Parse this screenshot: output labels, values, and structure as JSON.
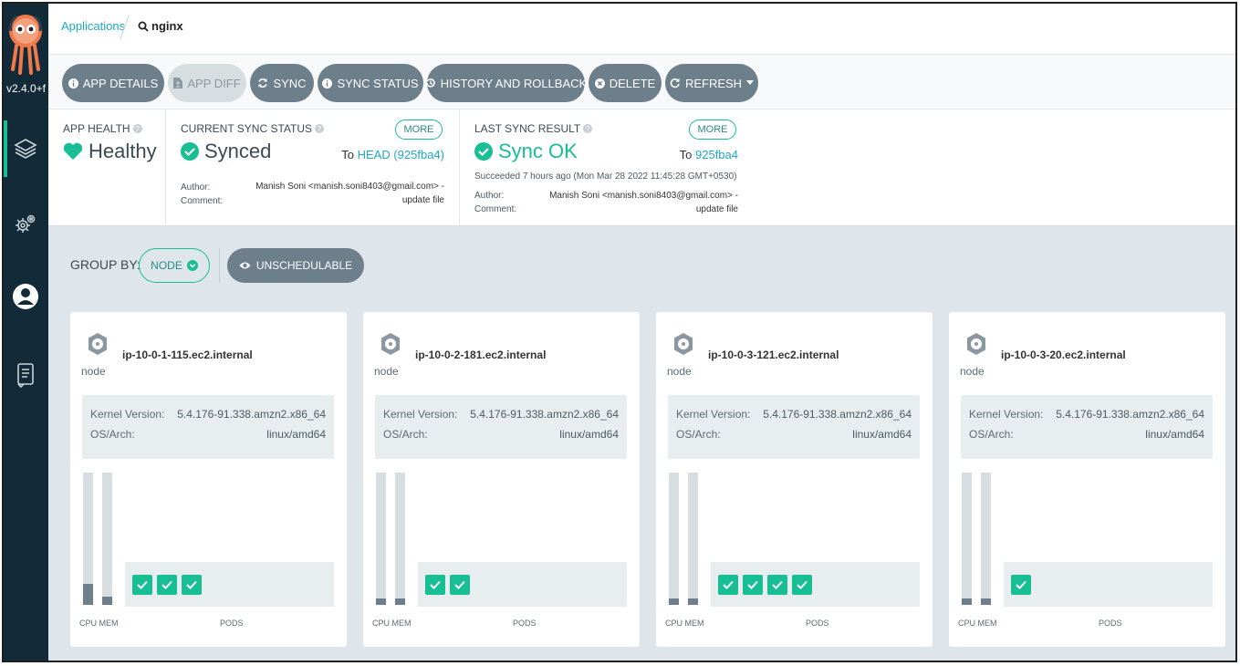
{
  "app": {
    "version": "v2.4.0+f"
  },
  "breadcrumb": {
    "parent": "Applications",
    "current": "nginx"
  },
  "toolbar": {
    "buttons": [
      {
        "label": "APP DETAILS",
        "icon": "info-icon"
      },
      {
        "label": "APP DIFF",
        "icon": "file-diff-icon",
        "disabled": true
      },
      {
        "label": "SYNC",
        "icon": "sync-icon"
      },
      {
        "label": "SYNC STATUS",
        "icon": "info-icon"
      },
      {
        "label": "HISTORY AND ROLLBACK",
        "icon": "history-icon"
      },
      {
        "label": "DELETE",
        "icon": "times-circle-icon"
      },
      {
        "label": "REFRESH",
        "icon": "redo-icon",
        "dropdown": true
      }
    ]
  },
  "status": {
    "health": {
      "title": "APP HEALTH",
      "value": "Healthy",
      "color": "#18be94"
    },
    "sync": {
      "title": "CURRENT SYNC STATUS",
      "value": "Synced",
      "more": "MORE",
      "to_prefix": "To",
      "to_rev": "HEAD (925fba4)",
      "author_label": "Author:",
      "comment_label": "Comment:",
      "author": "Manish Soni <manish.soni8403@gmail.com> -",
      "comment": "update file"
    },
    "last_sync": {
      "title": "LAST SYNC RESULT",
      "value": "Sync OK",
      "more": "MORE",
      "to_prefix": "To",
      "to_rev": "925fba4",
      "succeeded": "Succeeded 7 hours ago (Mon Mar 28 2022 11:45:28 GMT+0530)",
      "author_label": "Author:",
      "comment_label": "Comment:",
      "author": "Manish Soni <manish.soni8403@gmail.com> -",
      "comment": "update file"
    }
  },
  "group_by": {
    "label": "GROUP BY:",
    "selected": "NODE",
    "unschedulable": "UNSCHEDULABLE"
  },
  "nodes": [
    {
      "name": "ip-10-0-1-115.ec2.internal",
      "type": "node",
      "kernel_label": "Kernel Version:",
      "kernel": "5.4.176-91.338.amzn2.x86_64",
      "os_label": "OS/Arch:",
      "os": "linux/amd64",
      "cpu": 0.16,
      "mem": 0.06,
      "pods": 3
    },
    {
      "name": "ip-10-0-2-181.ec2.internal",
      "type": "node",
      "kernel_label": "Kernel Version:",
      "kernel": "5.4.176-91.338.amzn2.x86_64",
      "os_label": "OS/Arch:",
      "os": "linux/amd64",
      "cpu": 0.05,
      "mem": 0.0,
      "pods": 2
    },
    {
      "name": "ip-10-0-3-121.ec2.internal",
      "type": "node",
      "kernel_label": "Kernel Version:",
      "kernel": "5.4.176-91.338.amzn2.x86_64",
      "os_label": "OS/Arch:",
      "os": "linux/amd64",
      "cpu": 0.05,
      "mem": 0.0,
      "pods": 4
    },
    {
      "name": "ip-10-0-3-20.ec2.internal",
      "type": "node",
      "kernel_label": "Kernel Version:",
      "kernel": "5.4.176-91.338.amzn2.x86_64",
      "os_label": "OS/Arch:",
      "os": "linux/amd64",
      "cpu": 0.05,
      "mem": 0.0,
      "pods": 1
    }
  ],
  "labels": {
    "cpu_mem": "CPU MEM",
    "pods": "PODS"
  },
  "colors": {
    "accent": "#18be94",
    "link": "#1fa8c1",
    "button": "#6d7f8b",
    "sidebar": "#132a38"
  }
}
